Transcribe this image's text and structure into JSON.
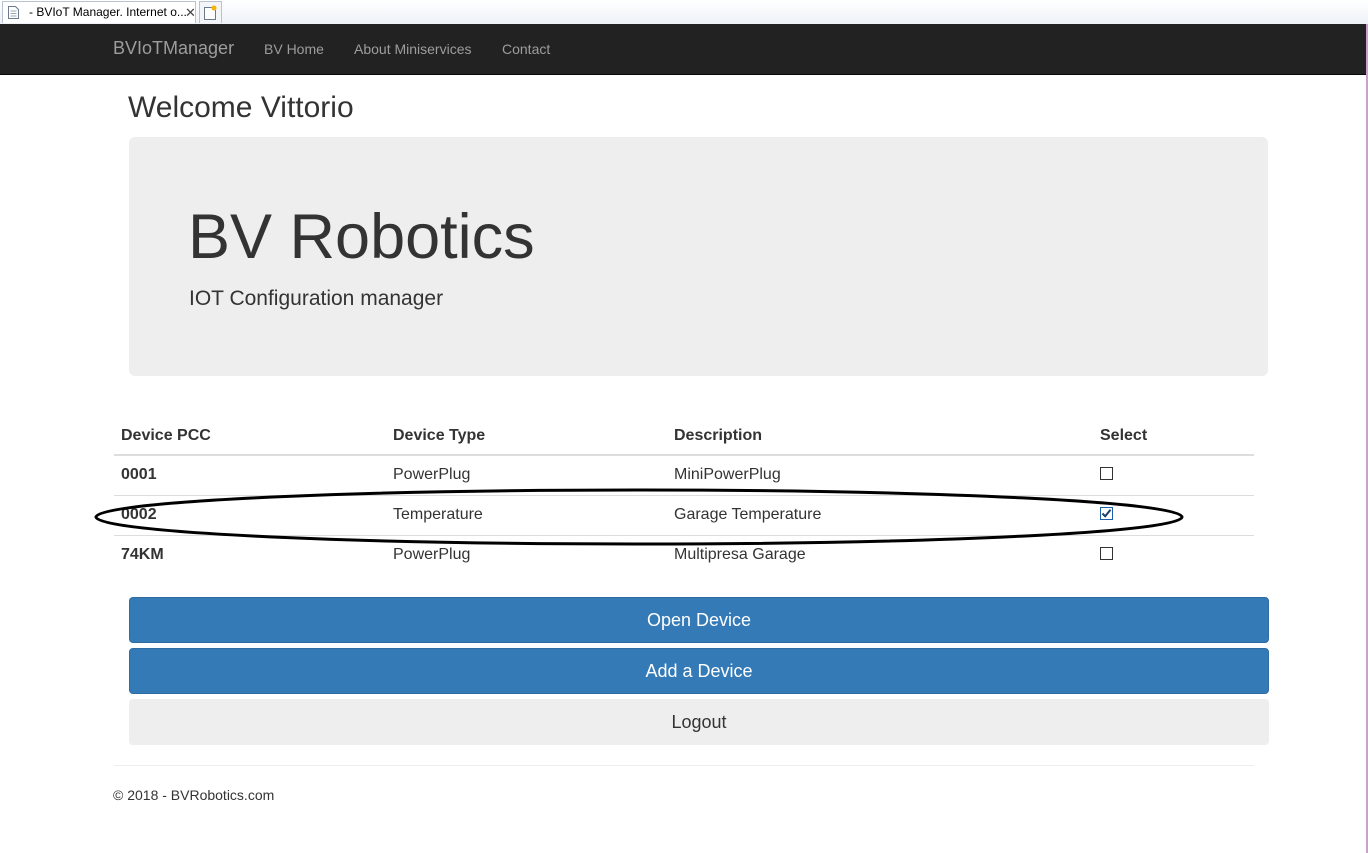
{
  "browser": {
    "tab_title": "- BVIoT Manager. Internet o...",
    "close_glyph": "✕"
  },
  "navbar": {
    "brand": "BVIoTManager",
    "links": [
      "BV Home",
      "About Miniservices",
      "Contact"
    ]
  },
  "page": {
    "welcome": "Welcome Vittorio"
  },
  "jumbotron": {
    "title": "BV Robotics",
    "subtitle": "IOT Configuration manager"
  },
  "table": {
    "headers": [
      "Device PCC",
      "Device Type",
      "Description",
      "Select"
    ],
    "rows": [
      {
        "pcc": "0001",
        "type": "PowerPlug",
        "description": "MiniPowerPlug",
        "selected": false
      },
      {
        "pcc": "0002",
        "type": "Temperature",
        "description": "Garage Temperature",
        "selected": true
      },
      {
        "pcc": "74KM",
        "type": "PowerPlug",
        "description": "Multipresa Garage",
        "selected": false
      }
    ]
  },
  "buttons": {
    "open": "Open Device",
    "add": "Add a Device",
    "logout": "Logout"
  },
  "footer": {
    "text": "© 2018 - BVRobotics.com"
  },
  "colors": {
    "navbar_bg": "#222222",
    "primary": "#337ab7",
    "jumbotron_bg": "#eeeeee"
  }
}
